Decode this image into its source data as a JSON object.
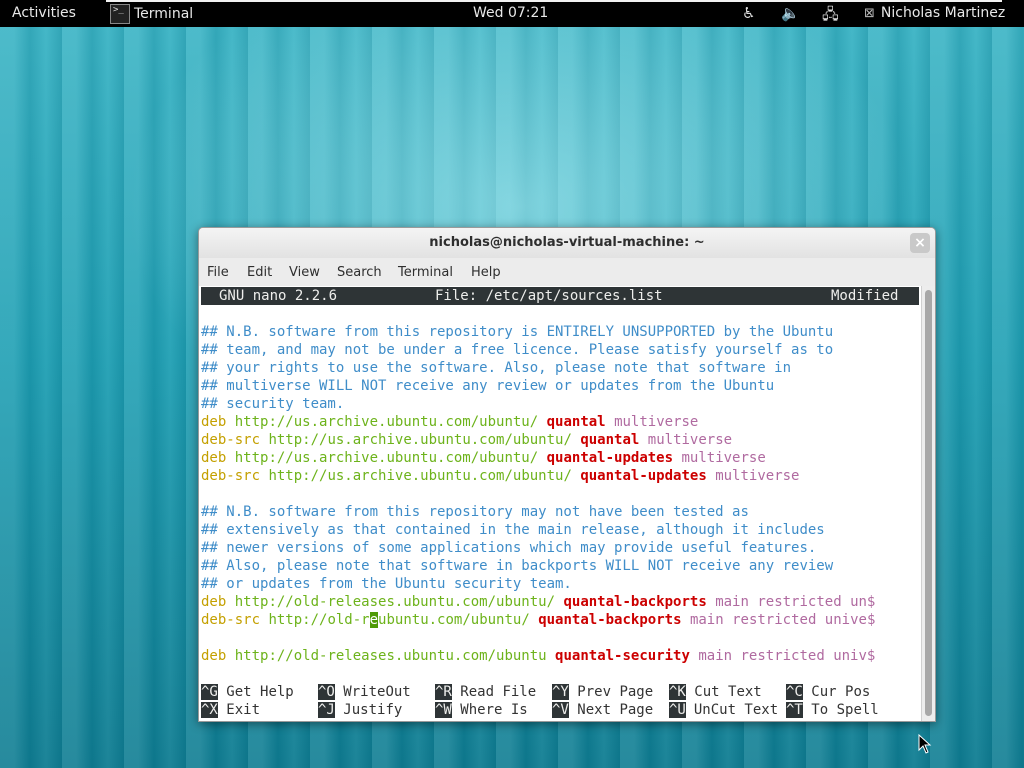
{
  "topbar": {
    "activities": "Activities",
    "app_name": "Terminal",
    "app_icon_text": ">_",
    "clock": "Wed 07:21",
    "user": "Nicholas Martinez",
    "icons": [
      "accessibility-icon",
      "volume-icon",
      "network-icon",
      "user-status-icon"
    ]
  },
  "window": {
    "title": "nicholas@nicholas-virtual-machine: ~",
    "close_glyph": "×",
    "menu": [
      "File",
      "Edit",
      "View",
      "Search",
      "Terminal",
      "Help"
    ]
  },
  "nano": {
    "version": "GNU nano 2.2.6",
    "file": "File: /etc/apt/sources.list",
    "status": "Modified",
    "comments1": [
      "## N.B. software from this repository is ENTIRELY UNSUPPORTED by the Ubuntu",
      "## team, and may not be under a free licence. Please satisfy yourself as to",
      "## your rights to use the software. Also, please note that software in",
      "## multiverse WILL NOT receive any review or updates from the Ubuntu",
      "## security team."
    ],
    "repo1": [
      {
        "type": "deb",
        "url": "http://us.archive.ubuntu.com/ubuntu/",
        "dist": "quantal",
        "comp": "multiverse"
      },
      {
        "type": "deb-src",
        "url": "http://us.archive.ubuntu.com/ubuntu/",
        "dist": "quantal",
        "comp": "multiverse"
      },
      {
        "type": "deb",
        "url": "http://us.archive.ubuntu.com/ubuntu/",
        "dist": "quantal-updates",
        "comp": "multiverse"
      },
      {
        "type": "deb-src",
        "url": "http://us.archive.ubuntu.com/ubuntu/",
        "dist": "quantal-updates",
        "comp": "multiverse"
      }
    ],
    "comments2": [
      "## N.B. software from this repository may not have been tested as",
      "## extensively as that contained in the main release, although it includes",
      "## newer versions of some applications which may provide useful features.",
      "## Also, please note that software in backports WILL NOT receive any review",
      "## or updates from the Ubuntu security team."
    ],
    "backports_deb": {
      "type": "deb",
      "url": "http://old-releases.ubuntu.com/ubuntu/",
      "dist": "quantal-backports",
      "comp": "main restricted un$"
    },
    "backports_src": {
      "type": "deb-src",
      "url_before": "http://old-r",
      "cursor_char": "e",
      "url_after": "ubuntu.com/ubuntu/",
      "dist": "quantal-backports",
      "comp": "main restricted unive$"
    },
    "security_deb": {
      "type": "deb",
      "url": "http://old-releases.ubuntu.com/ubuntu",
      "dist": "quantal-security",
      "comp": "main restricted univ$"
    },
    "shortcuts_row1": [
      {
        "key": "^G",
        "label": "Get Help"
      },
      {
        "key": "^O",
        "label": "WriteOut"
      },
      {
        "key": "^R",
        "label": "Read File"
      },
      {
        "key": "^Y",
        "label": "Prev Page"
      },
      {
        "key": "^K",
        "label": "Cut Text"
      },
      {
        "key": "^C",
        "label": "Cur Pos"
      }
    ],
    "shortcuts_row2": [
      {
        "key": "^X",
        "label": "Exit"
      },
      {
        "key": "^J",
        "label": "Justify"
      },
      {
        "key": "^W",
        "label": "Where Is"
      },
      {
        "key": "^V",
        "label": "Next Page"
      },
      {
        "key": "^U",
        "label": "UnCut Text"
      },
      {
        "key": "^T",
        "label": "To Spell"
      }
    ]
  }
}
